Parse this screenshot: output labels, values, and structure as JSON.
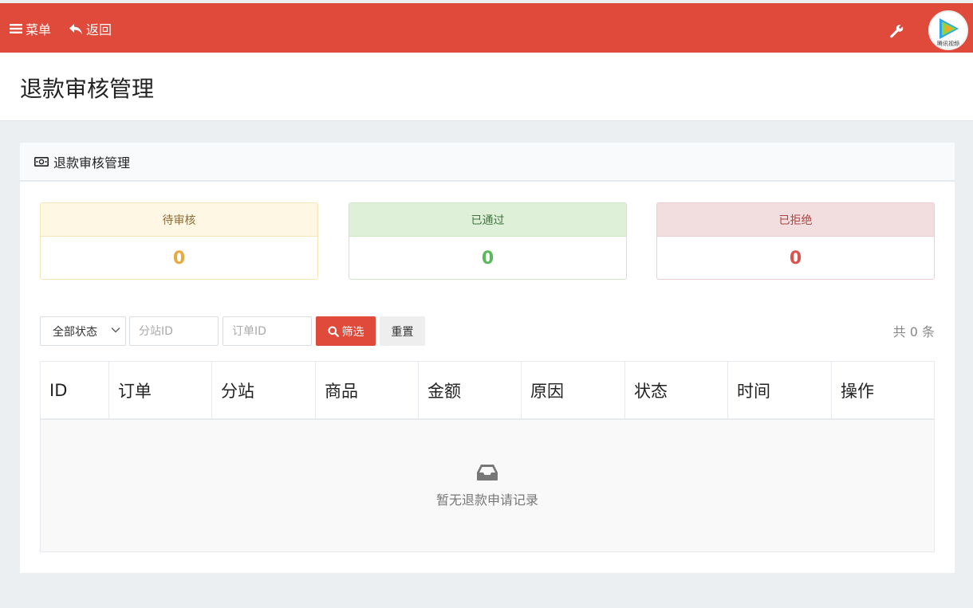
{
  "topbar": {
    "menu_label": "菜单",
    "back_label": "返回",
    "avatar_caption": "腾讯视频"
  },
  "page": {
    "title": "退款审核管理"
  },
  "panel": {
    "title": "退款审核管理"
  },
  "stats": [
    {
      "label": "待审核",
      "value": "0"
    },
    {
      "label": "已通过",
      "value": "0"
    },
    {
      "label": "已拒绝",
      "value": "0"
    }
  ],
  "filters": {
    "status_selected": "全部状态",
    "branch_placeholder": "分站ID",
    "order_placeholder": "订单ID",
    "filter_label": "筛选",
    "reset_label": "重置",
    "total_text": "共 0 条"
  },
  "table": {
    "columns": [
      "ID",
      "订单",
      "分站",
      "商品",
      "金额",
      "原因",
      "状态",
      "时间",
      "操作"
    ],
    "empty_text": "暂无退款申请记录"
  },
  "colors": {
    "brand": "#e04a3a",
    "pending": "#eaa93e",
    "approved": "#5cb85c",
    "rejected": "#d9534f"
  }
}
